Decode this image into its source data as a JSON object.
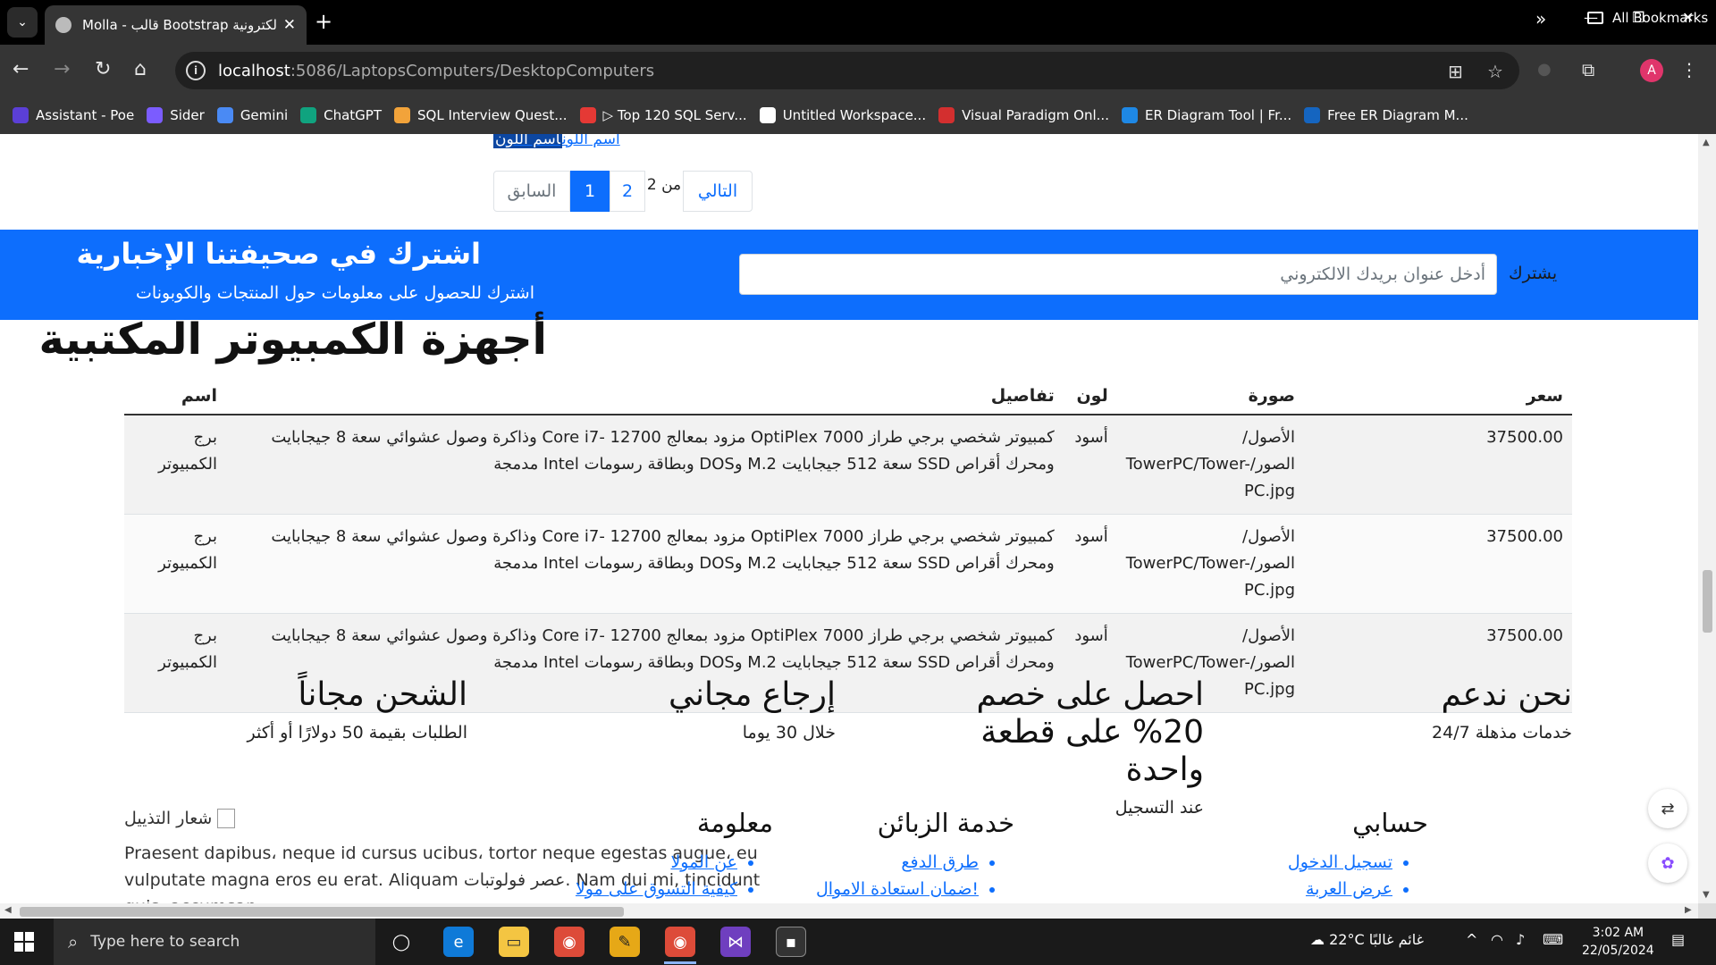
{
  "browser": {
    "tab_title": "Molla - قالب Bootstrap الإلكترونية",
    "tab_close": "✕",
    "new_tab": "+",
    "url_host": "localhost",
    "url_path": ":5086/LaptopsComputers/DesktopComputers",
    "bookmarks": [
      {
        "label": "Assistant - Poe",
        "color": "#5b3fd6"
      },
      {
        "label": "Sider",
        "color": "#7b5cff"
      },
      {
        "label": "Gemini",
        "color": "#4a8af4"
      },
      {
        "label": "ChatGPT",
        "color": "#10a37f"
      },
      {
        "label": "SQL Interview Quest...",
        "color": "#f2a33a"
      },
      {
        "label": "▷ Top 120 SQL Serv...",
        "color": "#e53935"
      },
      {
        "label": "Untitled Workspace...",
        "color": "#ffffff"
      },
      {
        "label": "Visual Paradigm Onl...",
        "color": "#d32f2f"
      },
      {
        "label": "ER Diagram Tool | Fr...",
        "color": "#1e88e5"
      },
      {
        "label": "Free ER Diagram M...",
        "color": "#1565c0"
      }
    ],
    "all_bookmarks": "All Bookmarks",
    "profile_initial": "A"
  },
  "page": {
    "color_link": "اسم اللون",
    "color_link_selected": "اسم اللون",
    "pager": {
      "prev": "السابق",
      "page1": "1",
      "page2": "2",
      "of_text": "من 2",
      "next": "التالي"
    },
    "newsletter": {
      "title": "اشترك في صحيفتنا الإخبارية",
      "subtitle": "اشترك للحصول على معلومات حول المنتجات والكوبونات",
      "placeholder": "أدخل عنوان بريدك الالكتروني",
      "button": "يشترك"
    },
    "title": "أجهزة الكمبيوتر المكتبية",
    "table": {
      "headers": {
        "price": "سعر",
        "image": "صورة",
        "color": "لون",
        "details": "تفاصيل",
        "name": "اسم"
      },
      "rows": [
        {
          "price": "37500.00",
          "image": "الأصول/الصور/TowerPC/Tower-PC.jpg",
          "color": "أسود",
          "details": "كمبيوتر شخصي برجي طراز OptiPlex 7000 مزود بمعالج Core i7- 12700 وذاكرة وصول عشوائي سعة 8 جيجابايت ومحرك أقراص SSD سعة 512 جيجابايت M.2 وDOS وبطاقة رسومات Intel مدمجة",
          "name": "برج الكمبيوتر"
        },
        {
          "price": "37500.00",
          "image": "الأصول/الصور/TowerPC/Tower-PC.jpg",
          "color": "أسود",
          "details": "كمبيوتر شخصي برجي طراز OptiPlex 7000 مزود بمعالج Core i7- 12700 وذاكرة وصول عشوائي سعة 8 جيجابايت ومحرك أقراص SSD سعة 512 جيجابايت M.2 وDOS وبطاقة رسومات Intel مدمجة",
          "name": "برج الكمبيوتر"
        },
        {
          "price": "37500.00",
          "image": "الأصول/الصور/TowerPC/Tower-PC.jpg",
          "color": "أسود",
          "details": "كمبيوتر شخصي برجي طراز OptiPlex 7000 مزود بمعالج Core i7- 12700 وذاكرة وصول عشوائي سعة 8 جيجابايت ومحرك أقراص SSD سعة 512 جيجابايت M.2 وDOS وبطاقة رسومات Intel مدمجة",
          "name": "برج الكمبيوتر"
        }
      ]
    },
    "features": [
      {
        "title": "نحن ندعم",
        "text": "خدمات مذهلة 24/7"
      },
      {
        "title": "احصل على خصم 20% على قطعة واحدة",
        "text": "عند التسجيل"
      },
      {
        "title": "إرجاع مجاني",
        "text": "خلال 30 يوما"
      },
      {
        "title": "الشحن مجاناً",
        "text": "الطلبات بقيمة 50 دولارًا أو أكثر"
      }
    ],
    "footer": {
      "logo_alt": "شعار التذييل",
      "about_text": "Praesent dapibus، neque id cursus ucibus، tortor neque egestas augue، eu vulputate magna eros eu erat. Aliquam عصر فولوتبات. Nam dui mi, tincidunt quis, accumsan",
      "account": {
        "title": "حسابي",
        "links": [
          "تسجيل الدخول",
          "عرض العربة"
        ]
      },
      "service": {
        "title": "خدمة الزبائن",
        "links": [
          "طرق الدفع",
          "!ضمان استعادة الاموال"
        ]
      },
      "info": {
        "title": "معلومة",
        "links": [
          "عن المولا",
          "كيفية التسوق على مولا"
        ]
      }
    }
  },
  "taskbar": {
    "search_placeholder": "Type here to search",
    "weather": "22°C  غائم غالبًا",
    "time": "3:02 AM",
    "date": "22/05/2024"
  }
}
